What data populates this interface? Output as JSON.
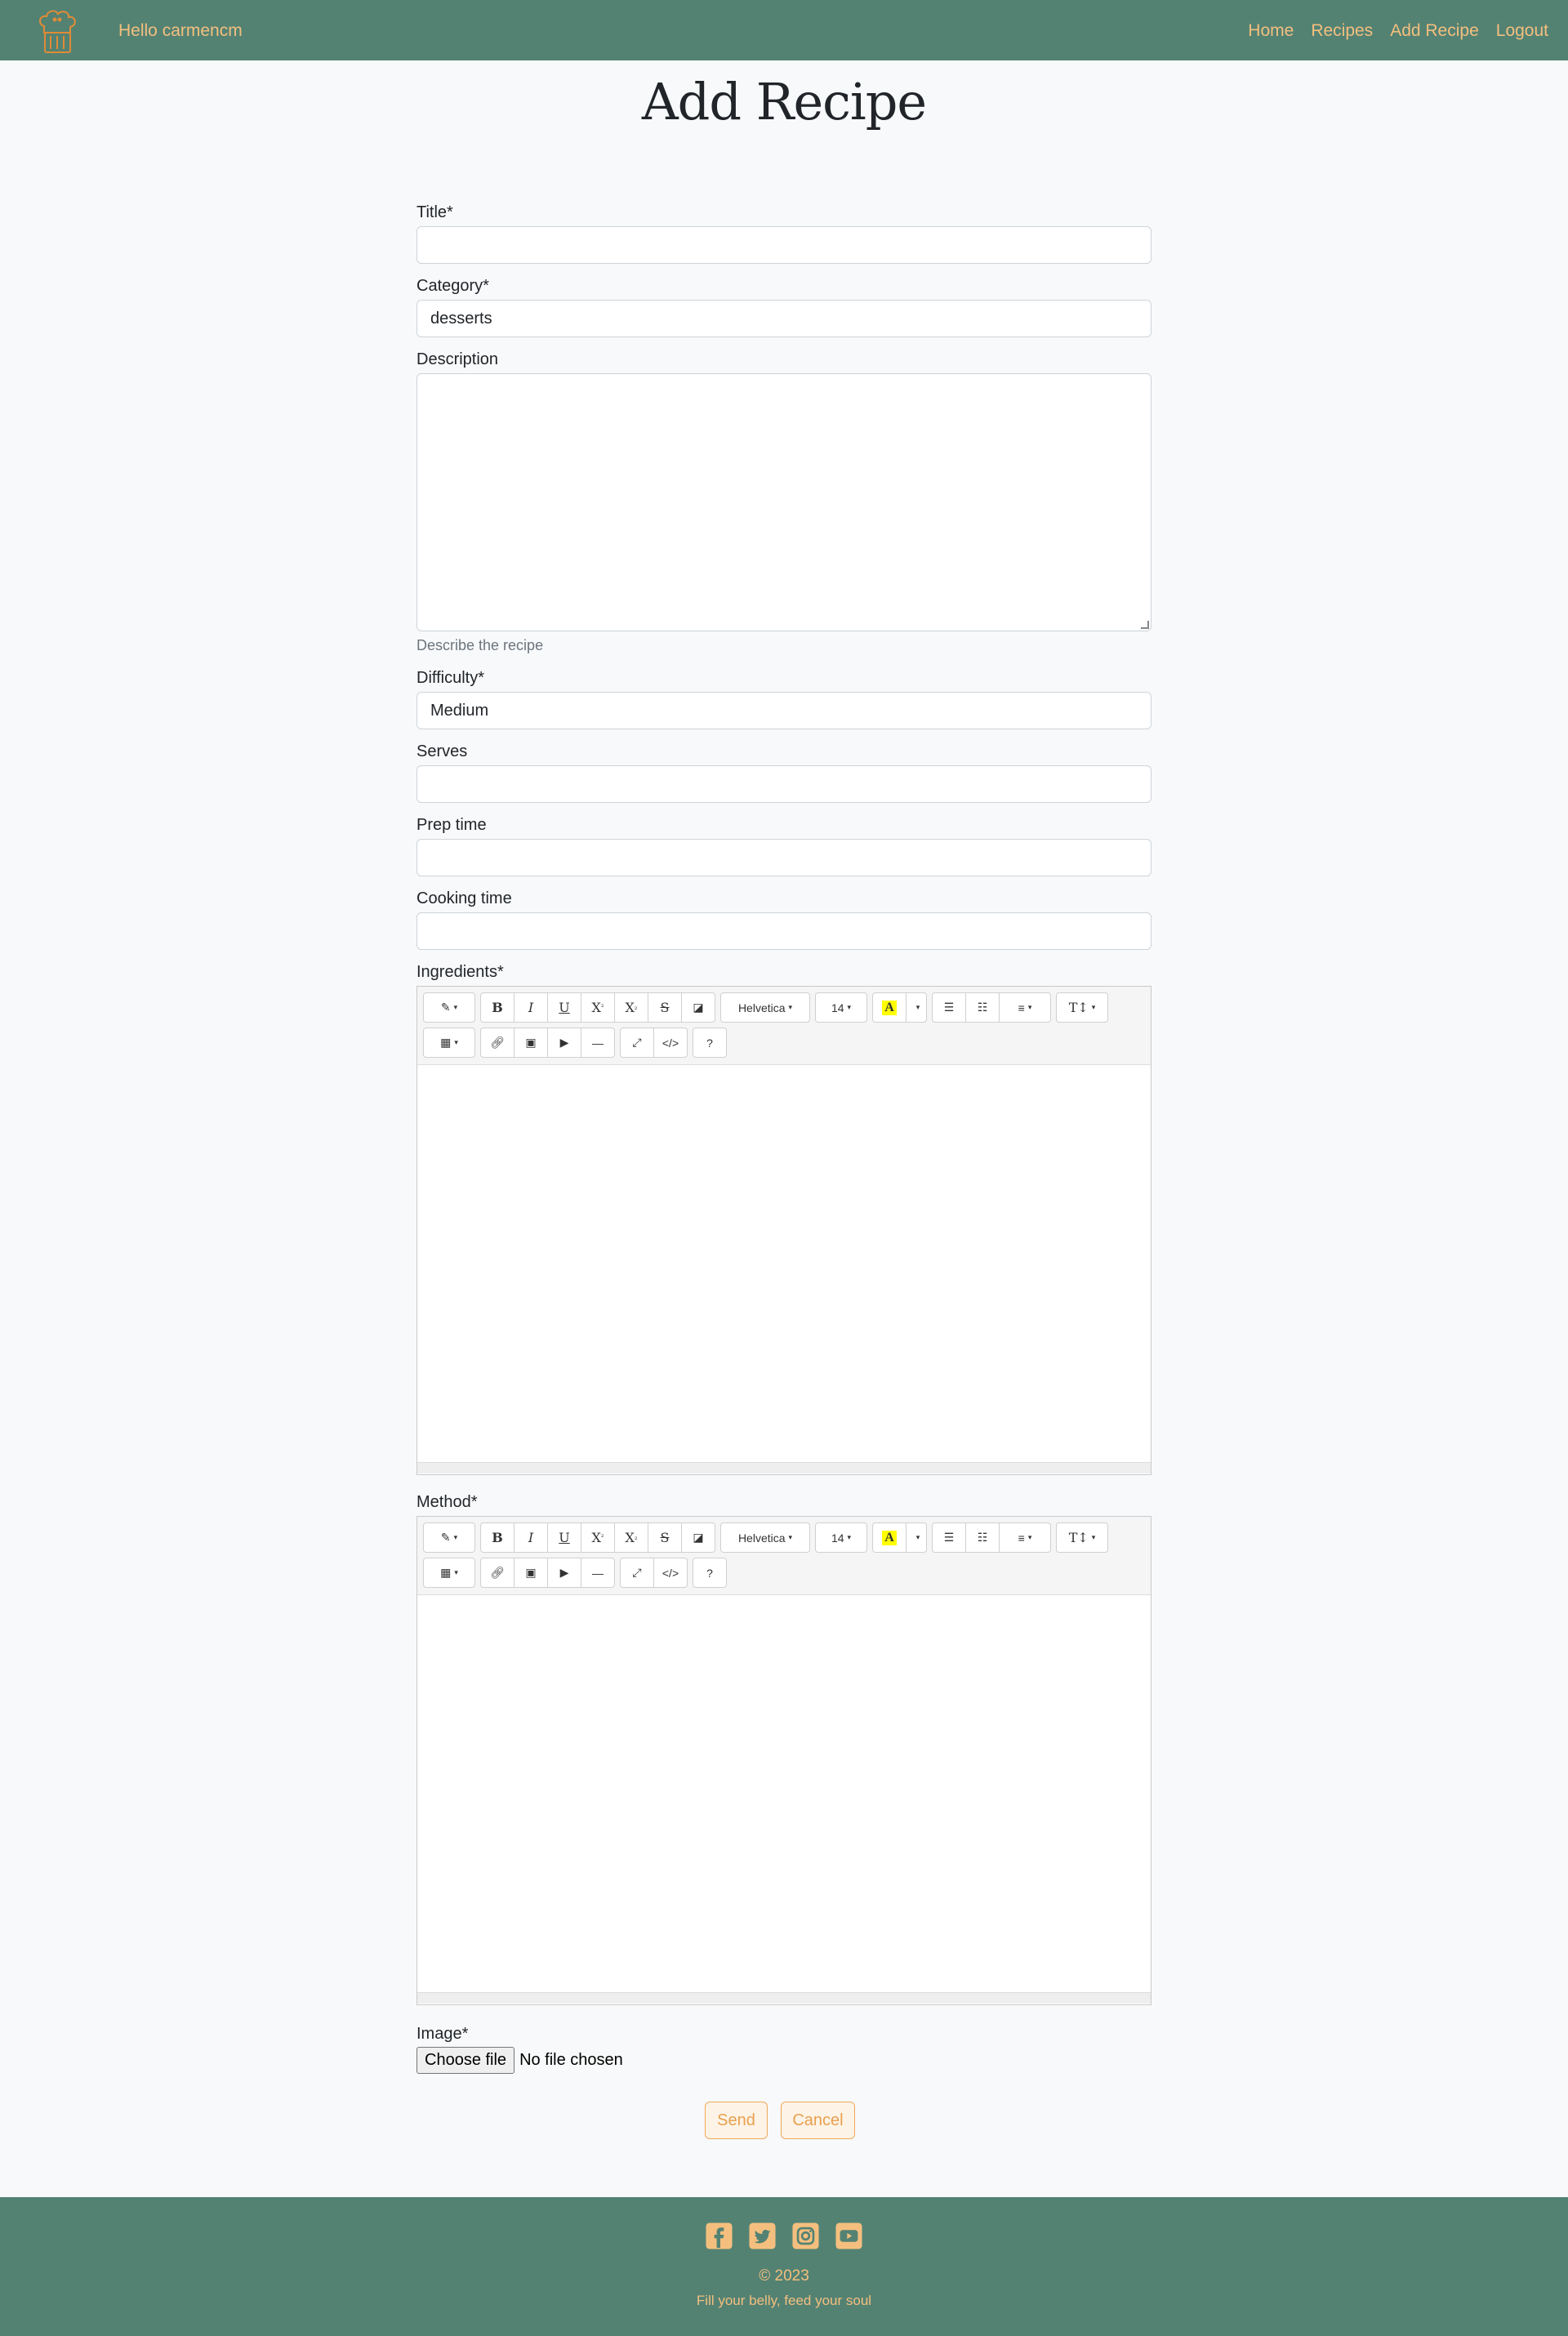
{
  "nav": {
    "greeting": "Hello carmencm",
    "links": [
      "Home",
      "Recipes",
      "Add Recipe",
      "Logout"
    ]
  },
  "page": {
    "title": "Add Recipe"
  },
  "form": {
    "title_label": "Title*",
    "title_value": "",
    "category_label": "Category*",
    "category_value": "desserts",
    "description_label": "Description",
    "description_value": "",
    "description_help": "Describe the recipe",
    "difficulty_label": "Difficulty*",
    "difficulty_value": "Medium",
    "serves_label": "Serves",
    "prep_label": "Prep time",
    "cooking_label": "Cooking time",
    "ingredients_label": "Ingredients*",
    "method_label": "Method*",
    "image_label": "Image*",
    "file_button": "Choose file",
    "file_status": "No file chosen",
    "send": "Send",
    "cancel": "Cancel"
  },
  "editor": {
    "font_family": "Helvetica",
    "font_size": "14",
    "help": "?",
    "icons": [
      "magic-icon",
      "bold-icon",
      "italic-icon",
      "underline-icon",
      "superscript-icon",
      "subscript-icon",
      "strikethrough-icon",
      "eraser-icon",
      "text-color-icon",
      "unordered-list-icon",
      "ordered-list-icon",
      "align-icon",
      "line-height-icon",
      "table-icon",
      "link-icon",
      "picture-icon",
      "video-icon",
      "horizontal-rule-icon",
      "fullscreen-icon",
      "code-view-icon"
    ]
  },
  "footer": {
    "social": [
      "facebook-icon",
      "twitter-icon",
      "instagram-icon",
      "youtube-icon"
    ],
    "copyright": "© 2023",
    "tagline": "Fill your belly, feed your soul"
  },
  "colors": {
    "brand": "#538273",
    "accent": "#f4bf7e",
    "button_text": "#e9a04e"
  }
}
